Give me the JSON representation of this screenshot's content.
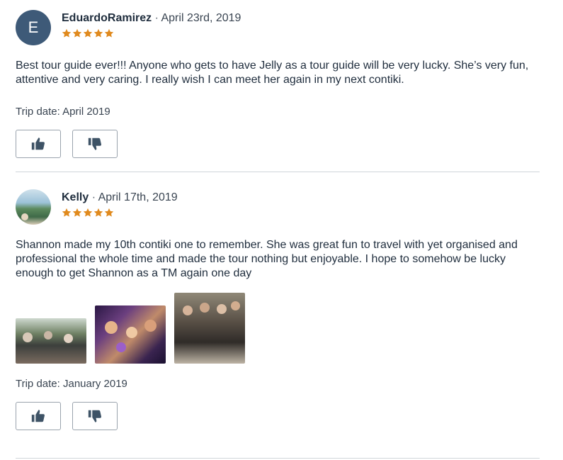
{
  "reviews": [
    {
      "avatar_letter": "E",
      "name": "EduardoRamirez",
      "separator": "·",
      "date": "April 23rd, 2019",
      "rating": 5,
      "body": "Best tour guide ever!!! Anyone who gets to have Jelly as a tour guide will be very lucky. She’s very fun, attentive and very caring. I really wish I can meet her again in my next contiki.",
      "trip_date": "Trip date: April 2019",
      "photos": []
    },
    {
      "avatar_letter": "",
      "name": "Kelly",
      "separator": "·",
      "date": "April 17th, 2019",
      "rating": 5,
      "body": "Shannon made my 10th contiki one to remember. She was great fun to travel with yet organised and professional the whole time and made the tour nothing but enjoyable. I hope to somehow be lucky enough to get Shannon as a TM again one day",
      "trip_date": "Trip date: January 2019",
      "photos": [
        "group-photo-outdoors",
        "group-photo-party",
        "group-photo-friends"
      ]
    }
  ],
  "icons": {
    "upvote": "thumbs-up-icon",
    "downvote": "thumbs-down-icon",
    "star": "star-icon"
  },
  "colors": {
    "star": "#e08a1e",
    "avatar_bg": "#3e5a78",
    "text": "#1f2d3d",
    "border": "#9aa3ad",
    "divider": "#d0d5da"
  }
}
